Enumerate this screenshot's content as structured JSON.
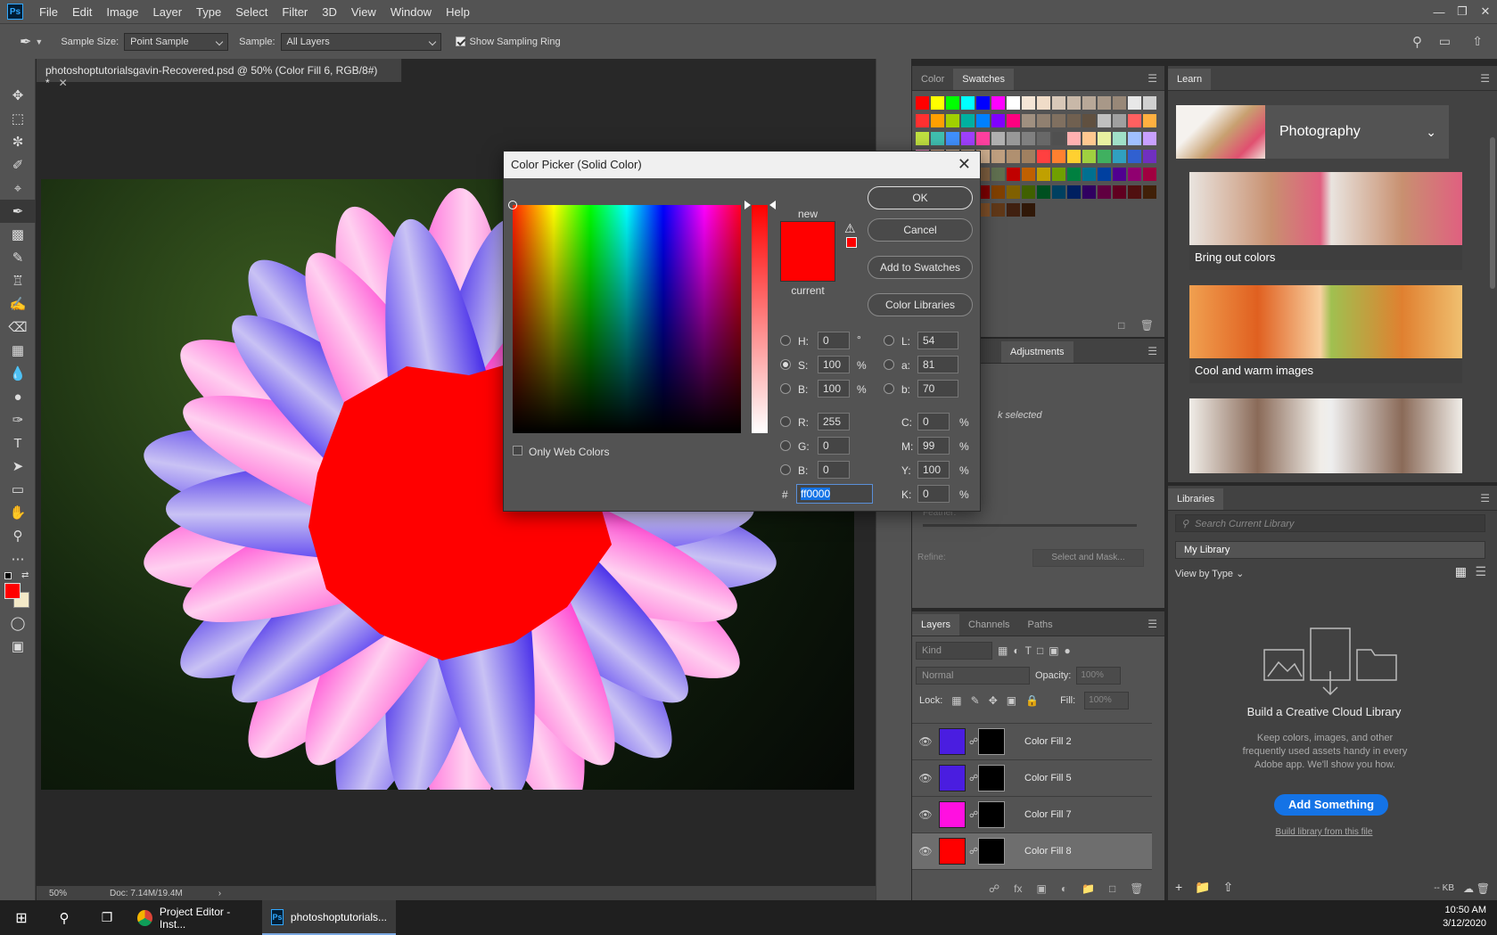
{
  "app": {
    "logo": "Ps",
    "menu": [
      "File",
      "Edit",
      "Image",
      "Layer",
      "Type",
      "Select",
      "Filter",
      "3D",
      "View",
      "Window",
      "Help"
    ],
    "window_controls": [
      "minimize-icon",
      "restore-icon",
      "close-icon"
    ]
  },
  "options": {
    "sample_size_label": "Sample Size:",
    "sample_size_value": "Point Sample",
    "sample_label": "Sample:",
    "sample_value": "All Layers",
    "sampling_ring_label": "Show Sampling Ring",
    "sampling_ring_checked": true
  },
  "document": {
    "tab_title": "photoshoptutorialsgavin-Recovered.psd @ 50% (Color Fill 6, RGB/8#) *",
    "zoom": "50%",
    "doc_size": "Doc: 7.14M/19.4M"
  },
  "color_picker": {
    "title": "Color Picker (Solid Color)",
    "new_label": "new",
    "current_label": "current",
    "only_web_colors": "Only Web Colors",
    "buttons": {
      "ok": "OK",
      "cancel": "Cancel",
      "add": "Add to Swatches",
      "libraries": "Color Libraries"
    },
    "fields": {
      "H": "0",
      "S": "100",
      "Bv": "100",
      "R": "255",
      "G": "0",
      "Bb": "0",
      "L": "54",
      "a": "81",
      "b": "70",
      "C": "0",
      "M": "99",
      "Y": "100",
      "K": "0",
      "hex": "ff0000"
    },
    "units": {
      "deg": "°",
      "pct": "%"
    },
    "labels": {
      "H": "H:",
      "S": "S:",
      "Bv": "B:",
      "R": "R:",
      "G": "G:",
      "Bb": "B:",
      "L": "L:",
      "a": "a:",
      "b": "b:",
      "C": "C:",
      "M": "M:",
      "Y": "Y:",
      "K": "K:",
      "hash": "#"
    },
    "new_color": "#ff0000",
    "current_color": "#ff0000"
  },
  "swatches_panel": {
    "tabs": [
      "Color",
      "Swatches"
    ],
    "active_tab": "Swatches"
  },
  "properties_panel": {
    "tab": "Adjustments",
    "mask_text": "k selected",
    "feather": "Feather:",
    "refine": "Refine:",
    "select_mask": "Select and Mask..."
  },
  "layers_panel": {
    "tabs": [
      "Layers",
      "Channels",
      "Paths"
    ],
    "kind": "Kind",
    "blend_mode": "Normal",
    "opacity_label": "Opacity:",
    "opacity": "100%",
    "lock_label": "Lock:",
    "fill_label": "Fill:",
    "fill": "100%",
    "layers": [
      {
        "name": "Color Fill 2",
        "color": "#4a1de0"
      },
      {
        "name": "Color Fill 5",
        "color": "#4a1de0"
      },
      {
        "name": "Color Fill 7",
        "color": "#ff10e0"
      },
      {
        "name": "Color Fill 8",
        "color": "#ff0000"
      }
    ]
  },
  "learn_panel": {
    "tab": "Learn",
    "category": "Photography",
    "items": [
      "Bring out colors",
      "Cool and warm images"
    ]
  },
  "libraries_panel": {
    "tab": "Libraries",
    "search_placeholder": "Search Current Library",
    "library": "My Library",
    "view_by": "View by Type",
    "heading": "Build a Creative Cloud Library",
    "body": "Keep colors, images, and other frequently used assets handy in every Adobe app. We'll show you how.",
    "button": "Add Something",
    "link": "Build library from this file",
    "kb": "-- KB"
  },
  "taskbar": {
    "apps": [
      "Project Editor - Inst...",
      "photoshoptutorials..."
    ],
    "time": "10:50 AM",
    "date": "3/12/2020"
  }
}
